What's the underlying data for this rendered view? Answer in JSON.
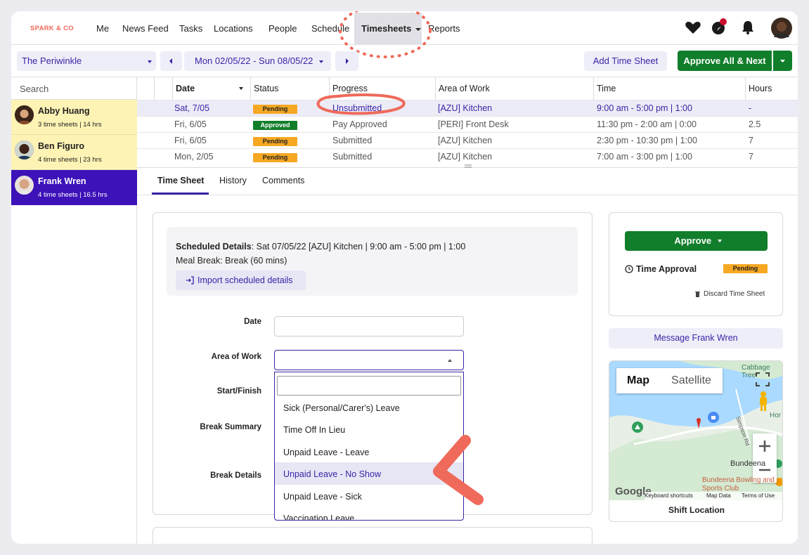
{
  "nav": {
    "logo": "SPARK & CO",
    "items": [
      "Me",
      "News Feed",
      "Tasks",
      "Locations",
      "People",
      "Schedule",
      "Timesheets",
      "Reports"
    ]
  },
  "toolbar": {
    "location": "The Periwinkle",
    "date_range": "Mon 02/05/22 - Sun 08/05/22",
    "add_label": "Add Time Sheet",
    "approve_next_label": "Approve All & Next"
  },
  "sidebar": {
    "search_placeholder": "Search",
    "people": [
      {
        "name": "Abby Huang",
        "summary": "3 time sheets | 14 hrs"
      },
      {
        "name": "Ben Figuro",
        "summary": "4 time sheets | 23 hrs"
      },
      {
        "name": "Frank Wren",
        "summary": "4 time sheets | 16.5 hrs"
      }
    ]
  },
  "table": {
    "headers": [
      "Date",
      "Status",
      "Progress",
      "Area of Work",
      "Time",
      "Hours"
    ],
    "rows": [
      {
        "date": "Sat, 7/05",
        "status": "Pending",
        "progress": "Unsubmitted",
        "area": "[AZU] Kitchen",
        "time": "9:00 am - 5:00 pm | 1:00",
        "hours": "-"
      },
      {
        "date": "Fri, 6/05",
        "status": "Approved",
        "progress": "Pay Approved",
        "area": "[PERI] Front Desk",
        "time": "11:30 pm - 2:00 am | 0:00",
        "hours": "2.5"
      },
      {
        "date": "Fri, 6/05",
        "status": "Pending",
        "progress": "Submitted",
        "area": "[AZU] Kitchen",
        "time": "2:30 pm - 10:30 pm | 1:00",
        "hours": "7"
      },
      {
        "date": "Mon, 2/05",
        "status": "Pending",
        "progress": "Submitted",
        "area": "[AZU] Kitchen",
        "time": "7:00 am - 3:00 pm | 1:00",
        "hours": "7"
      }
    ]
  },
  "tabs": [
    "Time Sheet",
    "History",
    "Comments"
  ],
  "form": {
    "sched_label": "Scheduled Details",
    "sched_value": ": Sat 07/05/22 [AZU] Kitchen | 9:00 am - 5:00 pm | 1:00",
    "meal_break": "Meal Break: Break (60 mins)",
    "import_label": "Import scheduled details",
    "date_label": "Date",
    "area_label": "Area of Work",
    "start_label": "Start/Finish",
    "break_summary_label": "Break Summary",
    "break_details_label": "Break Details",
    "options": [
      "Sick (Personal/Carer's) Leave",
      "Time Off In Lieu",
      "Unpaid Leave - Leave",
      "Unpaid Leave - No Show",
      "Unpaid Leave - Sick",
      "Vaccination Leave"
    ],
    "highlighted_option": "Unpaid Leave - No Show"
  },
  "approval": {
    "approve_label": "Approve",
    "time_approval_label": "Time Approval",
    "status": "Pending",
    "discard_label": "Discard Time Sheet",
    "message_label": "Message Frank Wren"
  },
  "map": {
    "map_tab": "Map",
    "satellite_tab": "Satellite",
    "shortcuts": "Keyboard shortcuts",
    "map_data": "Map Data",
    "terms": "Terms of Use",
    "caption": "Shift Location",
    "places": [
      "Cabbage Tree",
      "Bundeena",
      "Bundeena Bowling and Sports Club",
      "Simpson Rd",
      "Hor"
    ],
    "logo": "Google"
  },
  "colors": {
    "accent": "#3a24a6",
    "green": "#117e2b",
    "pending": "#f6a823",
    "annotation": "#ef6a5a",
    "selected_person": "#3d12b8",
    "highlight_person": "#fdf3b4"
  }
}
